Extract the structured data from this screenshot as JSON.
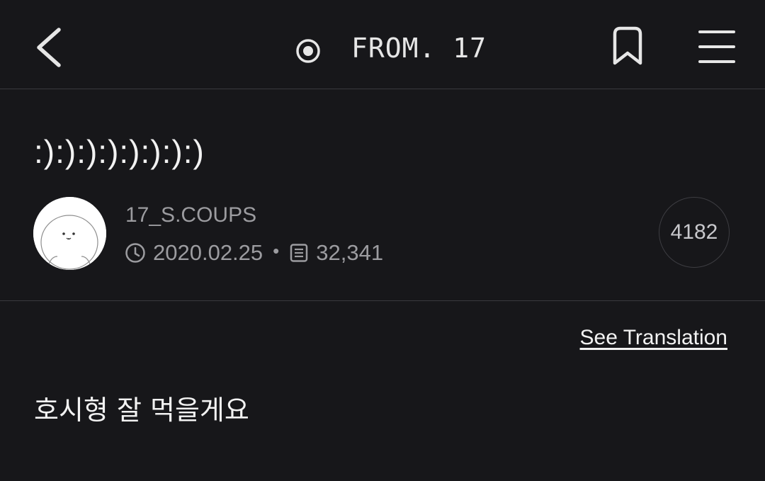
{
  "header": {
    "title": "FROM. 17",
    "back_icon": "chevron-left-icon",
    "live_icon": "radio-dot-icon",
    "bookmark_icon": "bookmark-icon",
    "menu_icon": "hamburger-menu-icon"
  },
  "post": {
    "title": ":):):):):):):):)",
    "author": "17_S.COUPS",
    "date": "2020.02.25",
    "separator": "•",
    "views": "32,341",
    "count": "4182",
    "body": "호시형 잘 먹을게요"
  },
  "actions": {
    "translate_label": "See Translation"
  },
  "colors": {
    "background": "#17171a",
    "divider": "#3a3a3e",
    "muted_text": "#9c9ca0",
    "text": "#f2f2f2"
  }
}
